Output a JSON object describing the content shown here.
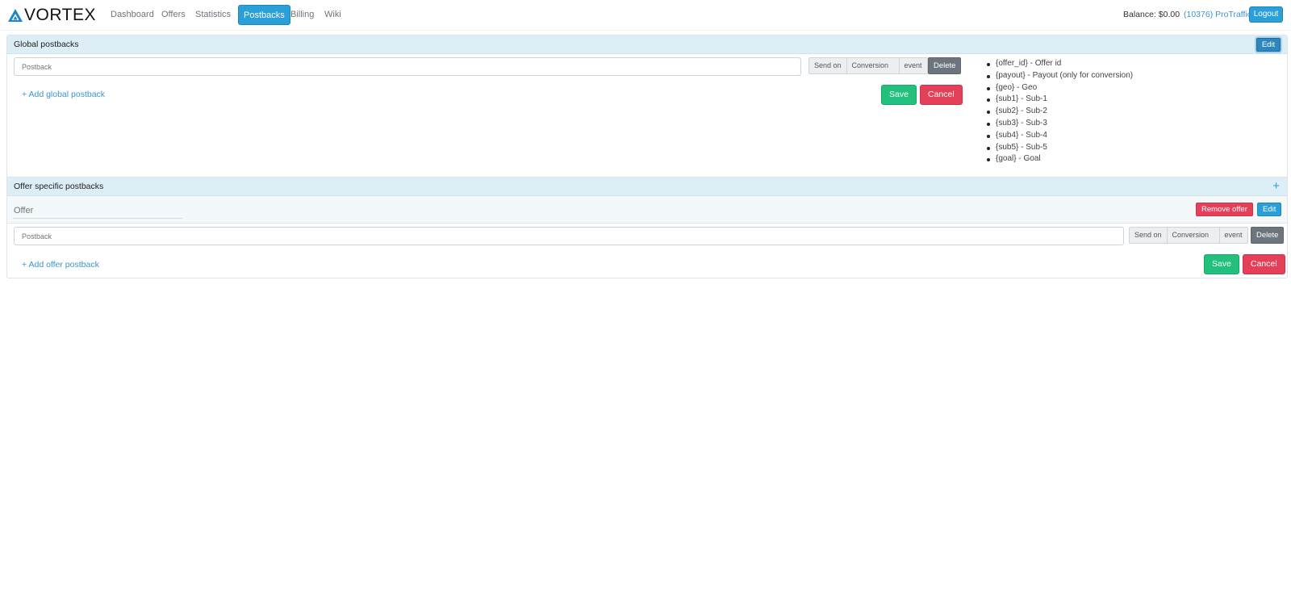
{
  "brand": {
    "name": "VORTEX",
    "icon": "triangle-logo-icon",
    "color": "#1f86c6"
  },
  "nav": {
    "items": [
      {
        "label": "Dashboard"
      },
      {
        "label": "Offers"
      },
      {
        "label": "Statistics"
      },
      {
        "label": "Postbacks",
        "active": true
      },
      {
        "label": "Billing"
      },
      {
        "label": "Wiki"
      }
    ]
  },
  "account": {
    "balance": "Balance: $0.00",
    "user": "(10376) ProTraffic",
    "logout_label": "Logout"
  },
  "global_postbacks": {
    "title": "Global postbacks",
    "edit_label": "Edit",
    "postback_placeholder": "Postback",
    "send_on_label": "Send on",
    "send_on_value": "Conversion",
    "event_label": "event",
    "delete_label": "Delete",
    "add_label": "+ Add global postback",
    "save_label": "Save",
    "cancel_label": "Cancel",
    "macros": [
      "{offer_id} - Offer id",
      "{payout} - Payout (only for conversion)",
      "{geo} - Geo",
      "{sub1} - Sub-1",
      "{sub2} - Sub-2",
      "{sub3} - Sub-3",
      "{sub4} - Sub-4",
      "{sub5} - Sub-5",
      "{goal} - Goal"
    ]
  },
  "offer_postbacks": {
    "title": "Offer specific postbacks",
    "add_offer_icon": "plus-icon",
    "offer_placeholder": "Offer",
    "remove_offer_label": "Remove offer",
    "edit_label": "Edit",
    "postback_placeholder": "Postback",
    "send_on_label": "Send on",
    "send_on_value": "Conversion",
    "event_label": "event",
    "delete_label": "Delete",
    "add_label": "+ Add offer postback",
    "save_label": "Save",
    "cancel_label": "Cancel"
  },
  "colors": {
    "primary": "#2b9fd8",
    "success": "#22c07c",
    "danger": "#e4405a",
    "secondary": "#6c757d",
    "panel_header": "#deeef7"
  }
}
